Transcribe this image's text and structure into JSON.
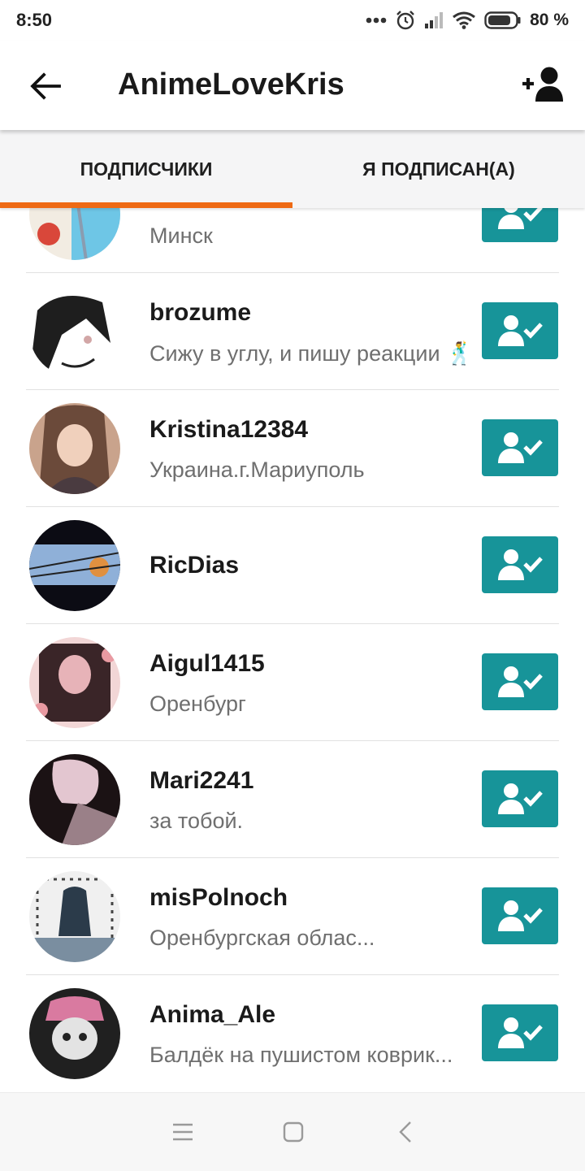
{
  "status_bar": {
    "time": "8:50",
    "battery": "80 %",
    "icons": [
      "more-dots-icon",
      "alarm-icon",
      "signal-icon",
      "wifi-icon",
      "battery-icon"
    ]
  },
  "app_bar": {
    "title": "AnimeLoveKris",
    "back_icon": "arrow-left-icon",
    "add_icon": "add-user-icon"
  },
  "tabs": [
    {
      "label": "ПОДПИСЧИКИ",
      "active": true
    },
    {
      "label": "Я ПОДПИСАН(А)",
      "active": false
    }
  ],
  "accent_color": "#ee6a14",
  "button_color": "#179499",
  "list": [
    {
      "name": "",
      "desc": "Минск",
      "avatar_colors": [
        "#6ec6e6",
        "#f2ece2",
        "#d9473a"
      ]
    },
    {
      "name": "brozume",
      "desc": "Сижу в углу, и пишу реакции 🕺",
      "avatar_colors": [
        "#ffffff",
        "#1e1e1e",
        "#d2a6a6"
      ]
    },
    {
      "name": "Kristina12384",
      "desc": "Украина.г.Мариуполь",
      "avatar_colors": [
        "#c9a38c",
        "#6b4a3a",
        "#4a3b40"
      ]
    },
    {
      "name": "RicDias",
      "desc": "",
      "avatar_colors": [
        "#0c0c14",
        "#8fb0d8",
        "#e09040"
      ]
    },
    {
      "name": "Aigul1415",
      "desc": "Оренбург",
      "avatar_colors": [
        "#3a2528",
        "#e7b3b8",
        "#f2d6d6"
      ]
    },
    {
      "name": "Mari2241",
      "desc": "за тобой.",
      "avatar_colors": [
        "#1b1214",
        "#e3c6d0",
        "#9a8088"
      ]
    },
    {
      "name": "misPolnoch",
      "desc": "Оренбургская облас...",
      "avatar_colors": [
        "#f0f0f0",
        "#2b3b4a",
        "#7a8ea0"
      ]
    },
    {
      "name": "Anima_Ale",
      "desc": "Балдёк на пушистом коврик...",
      "avatar_colors": [
        "#202020",
        "#e3e3e3",
        "#d97aa0"
      ]
    }
  ],
  "nav_bar": {
    "icons": [
      "menu-icon",
      "home-square-icon",
      "back-chevron-icon"
    ]
  }
}
